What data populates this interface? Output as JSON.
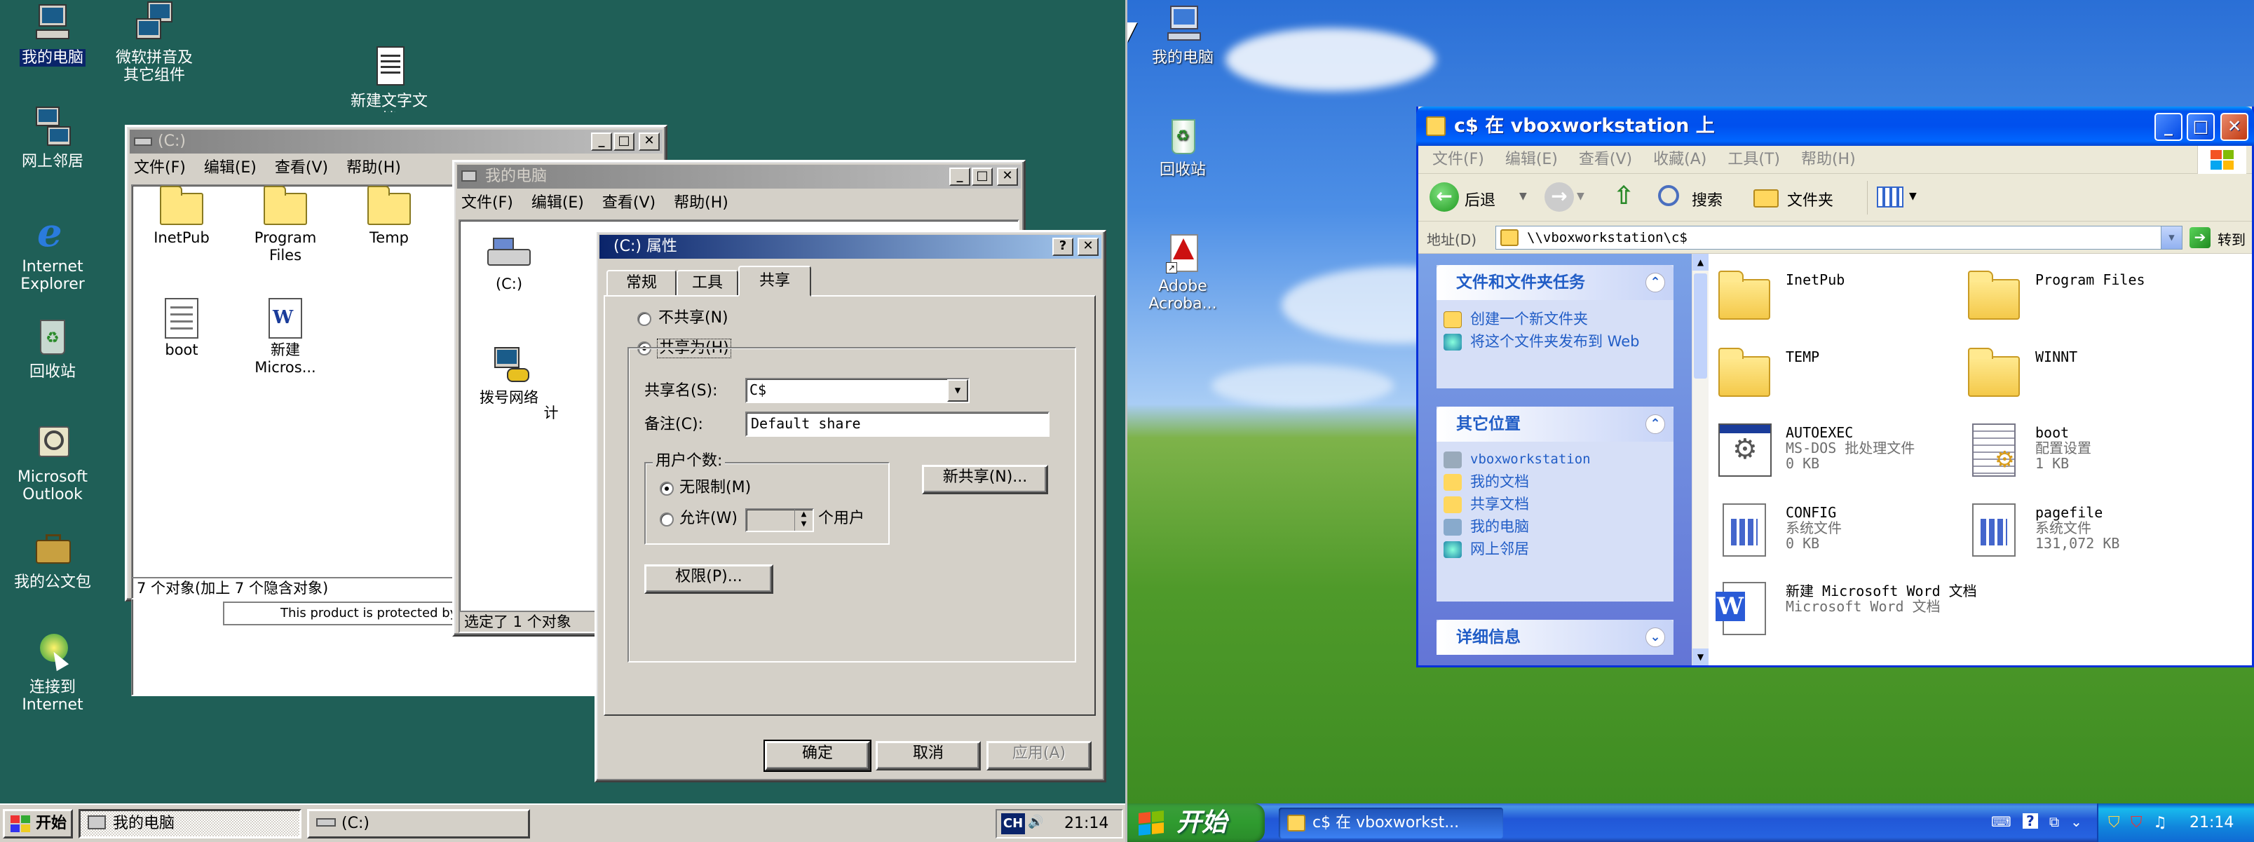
{
  "left": {
    "desktop_icons": [
      {
        "label": "我的电脑"
      },
      {
        "label": "微软拼音及其它组件"
      },
      {
        "label": "网上邻居"
      },
      {
        "label": "Internet Explorer"
      },
      {
        "label": "回收站"
      },
      {
        "label": "Microsoft Outlook"
      },
      {
        "label": "我的公文包"
      },
      {
        "label": "连接到 Internet"
      },
      {
        "label": "新建文字文档"
      }
    ],
    "c_window": {
      "title": "(C:)",
      "menu": [
        "文件(F)",
        "编辑(E)",
        "查看(V)",
        "帮助(H)"
      ],
      "items": [
        "InetPub",
        "Program Files",
        "Temp",
        "boot",
        "新建 Micros..."
      ],
      "status": "7 个对象(加上 7 个隐含对象)",
      "behind_text": "This product is protected by"
    },
    "mycomputer_window": {
      "title": "我的电脑",
      "menu": [
        "文件(F)",
        "编辑(E)",
        "查看(V)",
        "帮助(H)"
      ],
      "items": [
        "(C:)",
        "拨号网络",
        "计"
      ],
      "status": "选定了 1 个对象"
    },
    "props_dialog": {
      "title": "(C:) 属性",
      "tabs": [
        "常规",
        "工具",
        "共享"
      ],
      "radio_noshare": "不共享(N)",
      "radio_share": "共享为(H)",
      "share_name_label": "共享名(S):",
      "share_name_value": "C$",
      "comment_label": "备注(C):",
      "comment_value": "Default share",
      "user_limit_group": "用户个数:",
      "radio_unlimited": "无限制(M)",
      "radio_allow": "允许(W)",
      "users_suffix": "个用户",
      "new_share_button": "新共享(N)...",
      "permissions_button": "权限(P)...",
      "ok_button": "确定",
      "cancel_button": "取消",
      "apply_button": "应用(A)"
    },
    "taskbar": {
      "start": "开始",
      "tasks": [
        "我的电脑",
        "(C:)"
      ],
      "ime": "CH",
      "clock": "21:14"
    }
  },
  "right": {
    "desktop_icons": [
      {
        "label": "我的电脑"
      },
      {
        "label": "回收站"
      },
      {
        "label": "Adobe Acroba..."
      }
    ],
    "explorer": {
      "title": "c$ 在 vboxworkstation 上",
      "menu": [
        "文件(F)",
        "编辑(E)",
        "查看(V)",
        "收藏(A)",
        "工具(T)",
        "帮助(H)"
      ],
      "toolbar": {
        "back": "后退",
        "search": "搜索",
        "folders": "文件夹"
      },
      "address_label": "地址(D)",
      "address_value": "\\\\vboxworkstation\\c$",
      "go_button": "转到",
      "tasks_panel": {
        "title": "文件和文件夹任务",
        "links": [
          "创建一个新文件夹",
          "将这个文件夹发布到 Web"
        ]
      },
      "places_panel": {
        "title": "其它位置",
        "links": [
          "vboxworkstation",
          "我的文档",
          "共享文档",
          "我的电脑",
          "网上邻居"
        ]
      },
      "details_panel": {
        "title": "详细信息"
      },
      "files": [
        {
          "name": "InetPub",
          "type": "",
          "size": "",
          "kind": "folder"
        },
        {
          "name": "Program Files",
          "type": "",
          "size": "",
          "kind": "folder"
        },
        {
          "name": "TEMP",
          "type": "",
          "size": "",
          "kind": "folder"
        },
        {
          "name": "WINNT",
          "type": "",
          "size": "",
          "kind": "folder"
        },
        {
          "name": "AUTOEXEC",
          "type": "MS-DOS 批处理文件",
          "size": "0 KB",
          "kind": "bat"
        },
        {
          "name": "boot",
          "type": "配置设置",
          "size": "1 KB",
          "kind": "ini"
        },
        {
          "name": "CONFIG",
          "type": "系统文件",
          "size": "0 KB",
          "kind": "sys"
        },
        {
          "name": "pagefile",
          "type": "系统文件",
          "size": "131,072 KB",
          "kind": "sys"
        },
        {
          "name": "新建 Microsoft Word 文档",
          "type": "Microsoft Word 文档",
          "size": "",
          "kind": "doc"
        }
      ]
    },
    "taskbar": {
      "start": "开始",
      "tasks": [
        "c$ 在 vboxworkst..."
      ],
      "clock": "21:14"
    }
  }
}
